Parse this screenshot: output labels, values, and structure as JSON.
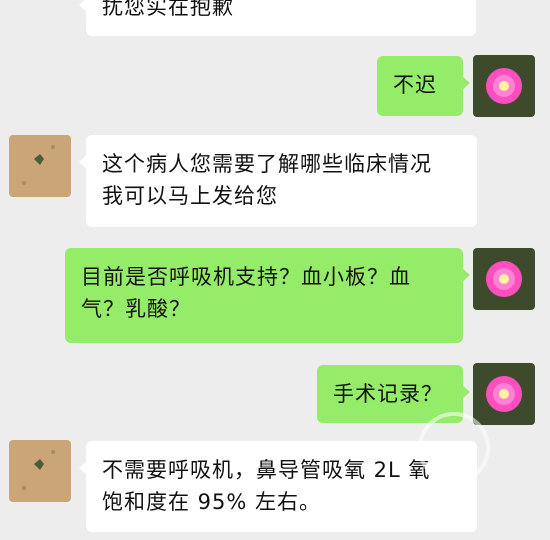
{
  "chat": {
    "messages": [
      {
        "sender": "contact",
        "text": "扰您实在抱歉"
      },
      {
        "sender": "me",
        "text": "不迟"
      },
      {
        "sender": "contact",
        "lines": [
          "这个病人您需要了解哪些临床情况",
          "我可以马上发给您"
        ]
      },
      {
        "sender": "me",
        "lines": [
          "目前是否呼吸机支持？血小板？血",
          "气？乳酸？"
        ]
      },
      {
        "sender": "me",
        "text": "手术记录？"
      },
      {
        "sender": "contact",
        "lines": [
          "不需要呼吸机，鼻导管吸氧 2L 氧",
          "饱和度在 95% 左右。"
        ]
      }
    ]
  },
  "colors": {
    "background": "#ededed",
    "incoming_bubble": "#ffffff",
    "outgoing_bubble": "#95ec69"
  },
  "icons": {
    "contact_avatar": "sand-photo-avatar",
    "my_avatar": "pink-flower-avatar"
  }
}
